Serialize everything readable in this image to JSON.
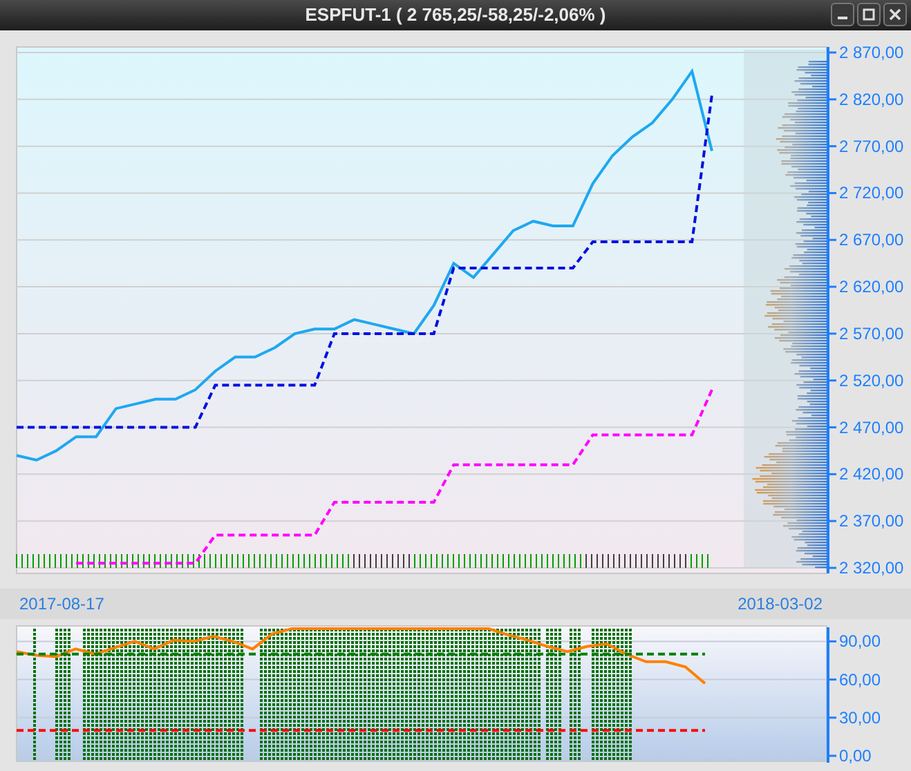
{
  "window": {
    "title": "ESPFUT-1 ( 2 765,25/-58,25/-2,06% )"
  },
  "price_panel": {
    "chart_data": {
      "type": "line",
      "ylim": [
        2320,
        2870
      ],
      "grid": true,
      "yticks": [
        {
          "value": 2320,
          "label": "2 320,00"
        },
        {
          "value": 2370,
          "label": "2 370,00"
        },
        {
          "value": 2420,
          "label": "2 420,00"
        },
        {
          "value": 2470,
          "label": "2 470,00"
        },
        {
          "value": 2520,
          "label": "2 520,00"
        },
        {
          "value": 2570,
          "label": "2 570,00"
        },
        {
          "value": 2620,
          "label": "2 620,00"
        },
        {
          "value": 2670,
          "label": "2 670,00"
        },
        {
          "value": 2720,
          "label": "2 720,00"
        },
        {
          "value": 2770,
          "label": "2 770,00"
        },
        {
          "value": 2820,
          "label": "2 820,00"
        },
        {
          "value": 2870,
          "label": "2 870,00"
        }
      ],
      "series": [
        {
          "color": "#1ea8f0",
          "line_style": "solid",
          "values": [
            2440,
            2435,
            2445,
            2460,
            2460,
            2490,
            2495,
            2500,
            2500,
            2510,
            2530,
            2545,
            2545,
            2555,
            2570,
            2575,
            2575,
            2585,
            2580,
            2575,
            2570,
            2600,
            2645,
            2630,
            2655,
            2680,
            2690,
            2685,
            2685,
            2730,
            2760,
            2780,
            2795,
            2820,
            2850,
            2765
          ]
        },
        {
          "color": "#0010e0",
          "line_style": "dashed",
          "values": [
            2470,
            2470,
            2470,
            2470,
            2470,
            2470,
            2470,
            2470,
            2470,
            2470,
            2515,
            2515,
            2515,
            2515,
            2515,
            2515,
            2570,
            2570,
            2570,
            2570,
            2570,
            2570,
            2640,
            2640,
            2640,
            2640,
            2640,
            2640,
            2640,
            2668,
            2668,
            2668,
            2668,
            2668,
            2668,
            2825
          ]
        },
        {
          "color": "#ff00ff",
          "line_style": "dashed",
          "values": [
            null,
            null,
            null,
            2325,
            2325,
            2325,
            2325,
            2325,
            2325,
            2325,
            2355,
            2355,
            2355,
            2355,
            2355,
            2355,
            2390,
            2390,
            2390,
            2390,
            2390,
            2390,
            2430,
            2430,
            2430,
            2430,
            2430,
            2430,
            2430,
            2462,
            2462,
            2462,
            2462,
            2462,
            2462,
            2510
          ]
        }
      ]
    },
    "date_labels": [
      "2017-08-17",
      "2018-03-02"
    ]
  },
  "indicator_panel": {
    "chart_data": {
      "type": "line",
      "ylim": [
        0,
        100
      ],
      "grid": true,
      "yticks": [
        {
          "value": 0,
          "label": "0,00"
        },
        {
          "value": 30,
          "label": "30,00"
        },
        {
          "value": 60,
          "label": "60,00"
        },
        {
          "value": 90,
          "label": "90,00"
        }
      ],
      "series": [
        {
          "color": "#ff8000",
          "line_style": "solid",
          "values": [
            82,
            79,
            78,
            84,
            80,
            85,
            90,
            84,
            91,
            90,
            94,
            90,
            84,
            96,
            100,
            100,
            100,
            100,
            100,
            100,
            100,
            100,
            100,
            100,
            100,
            95,
            91,
            86,
            82,
            86,
            88,
            80,
            74,
            74,
            70,
            57
          ]
        },
        {
          "color": "#008000",
          "line_style": "dashed",
          "values": [
            80,
            80,
            80,
            80,
            80,
            80,
            80,
            80,
            80,
            80,
            80,
            80,
            80,
            80,
            80,
            80,
            80,
            80,
            80,
            80,
            80,
            80,
            80,
            80,
            80,
            80,
            80,
            80,
            80,
            80,
            80,
            80,
            80,
            80,
            80,
            80
          ]
        },
        {
          "color": "#ff0000",
          "line_style": "dashed",
          "values": [
            20,
            20,
            20,
            20,
            20,
            20,
            20,
            20,
            20,
            20,
            20,
            20,
            20,
            20,
            20,
            20,
            20,
            20,
            20,
            20,
            20,
            20,
            20,
            20,
            20,
            20,
            20,
            20,
            20,
            20,
            20,
            20,
            20,
            20,
            20,
            20
          ]
        }
      ]
    }
  }
}
